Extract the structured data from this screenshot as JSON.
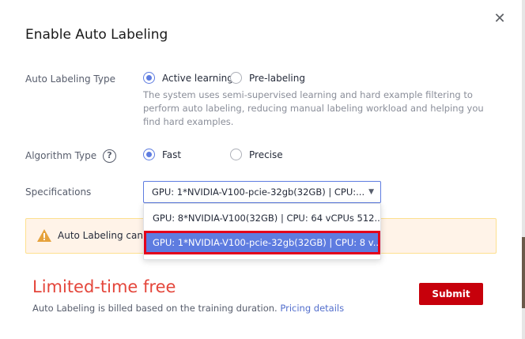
{
  "dialog": {
    "title": "Enable Auto Labeling",
    "close_icon": "close-icon"
  },
  "labeling_type": {
    "label": "Auto Labeling Type",
    "options": [
      {
        "label": "Active learning",
        "checked": true
      },
      {
        "label": "Pre-labeling",
        "checked": false
      }
    ],
    "description": "The system uses semi-supervised learning and hard example filtering to perform auto labeling, reducing manual labeling workload and helping you find hard examples."
  },
  "algorithm_type": {
    "label": "Algorithm Type",
    "help_glyph": "?",
    "options": [
      {
        "label": "Fast",
        "checked": true
      },
      {
        "label": "Precise",
        "checked": false
      }
    ]
  },
  "specifications": {
    "label": "Specifications",
    "selected_value": "GPU: 1*NVIDIA-V100-pcie-32gb(32GB) | CPU:...",
    "caret_icon": "caret-down-icon",
    "dropdown": [
      {
        "label": "GPU: 8*NVIDIA-V100(32GB) | CPU: 64 vCPUs 512...",
        "selected": false
      },
      {
        "label": "GPU: 1*NVIDIA-V100-pcie-32gb(32GB) | CPU: 8 v...",
        "selected": true
      }
    ]
  },
  "alert": {
    "icon": "warning-icon",
    "text": "Auto Labeling can incur charges",
    "color": "#fff3e8"
  },
  "promo": {
    "title": "Limited-time free",
    "note": "Auto Labeling is billed based on the training duration.",
    "link": "Pricing details"
  },
  "actions": {
    "submit_label": "Submit",
    "submit_color": "#c7000b"
  },
  "colors": {
    "accent": "#5e7ce0",
    "highlight_border": "#e4001b",
    "promo_red": "#e4463b"
  }
}
